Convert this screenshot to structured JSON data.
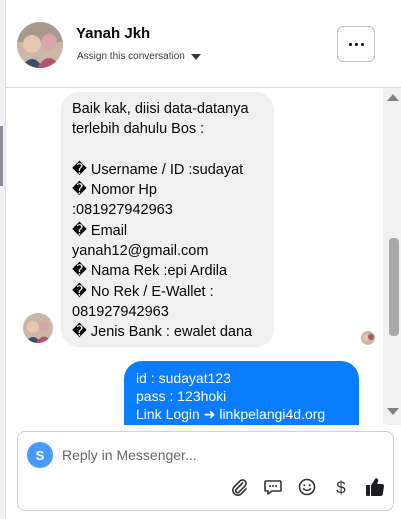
{
  "header": {
    "name": "Yanah Jkh",
    "assign_label": "Assign this conversation"
  },
  "messages": {
    "incoming_lines": [
      "Baik kak, diisi data-datanya",
      "terlebih dahulu Bos :",
      "",
      "� Username / ID :sudayat",
      "� Nomor Hp",
      ":081927942963",
      "� Email",
      "yanah12@gmail.com",
      "� Nama Rek :epi Ardila",
      "� No Rek / E-Wallet :",
      "081927942963",
      "� Jenis Bank : ewalet dana"
    ],
    "outgoing_lines": [
      "id : sudayat123",
      "pass : 123hoki",
      "Link Login ➜ linkpelangi4d.org"
    ]
  },
  "composer": {
    "avatar_letter": "S",
    "placeholder": "Reply in Messenger..."
  },
  "icons": [
    "more-options-icon",
    "chevron-down-icon",
    "attachment-icon",
    "saved-replies-icon",
    "emoji-icon",
    "payment-icon",
    "like-icon"
  ],
  "colors": {
    "outgoing_bubble": "#0a7cff",
    "incoming_bubble": "#f0f0f0",
    "composer_avatar": "#4599ff"
  }
}
